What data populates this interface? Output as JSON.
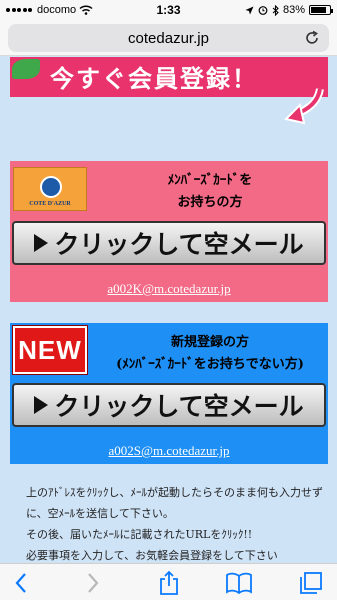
{
  "status_bar": {
    "carrier": "docomo",
    "time": "1:33",
    "battery": "83%"
  },
  "browser": {
    "url": "cotedazur.jp"
  },
  "banner": {
    "text": "今すぐ会員登録！"
  },
  "member_section": {
    "heading_line1": "ﾒﾝﾊﾞｰｽﾞｶｰﾄﾞを",
    "heading_line2": "お持ちの方",
    "logo_text": "COTE D'AZUR",
    "button_label": "クリックして空メール",
    "email": "a002K@m.cotedazur.jp"
  },
  "new_section": {
    "badge": "NEW",
    "heading_line1": "新規登録の方",
    "heading_line2": "(ﾒﾝﾊﾞｰｽﾞｶｰﾄﾞをお持ちでない方)",
    "button_label": "クリックして空メール",
    "email": "a002S@m.cotedazur.jp"
  },
  "instructions": {
    "line1": "上のｱﾄﾞﾚｽをｸﾘｯｸし、ﾒｰﾙが起動したらそのまま何も入力せず",
    "line2": "に、空ﾒｰﾙを送信して下さい。",
    "line3": "その後、届いたﾒｰﾙに記載されたURLをｸﾘｯｸ!!",
    "line4": "必要事項を入力して、お気軽会員登録をして下さい"
  },
  "colors": {
    "pink": "#f26a86",
    "blue": "#1e8ff5",
    "background": "#cfe3f7",
    "banner": "#e8336d",
    "accent": "#0a7aff"
  },
  "toolbar_icons": [
    "back-icon",
    "forward-icon",
    "share-icon",
    "bookmarks-icon",
    "tabs-icon"
  ]
}
